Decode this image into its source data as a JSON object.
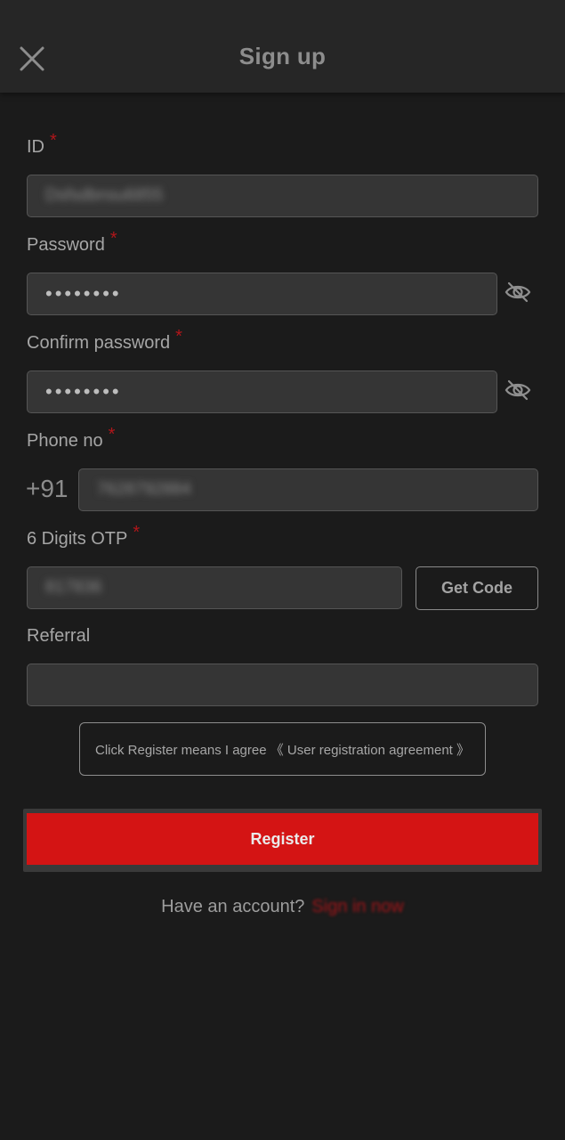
{
  "header": {
    "title": "Sign up",
    "close_icon": "close-icon"
  },
  "form": {
    "required_mark": "*",
    "id": {
      "label": "ID",
      "value": "Dsfsdbnsu6855"
    },
    "password": {
      "label": "Password",
      "value": "••••••••",
      "toggle_icon": "eye-off-icon"
    },
    "confirm_password": {
      "label": "Confirm password",
      "value": "••••••••",
      "toggle_icon": "eye-off-icon"
    },
    "phone": {
      "label": "Phone no",
      "prefix": "+91",
      "value": "7628792884"
    },
    "otp": {
      "label": "6 Digits OTP",
      "value": "817836",
      "get_code_label": "Get Code"
    },
    "referral": {
      "label": "Referral",
      "value": ""
    }
  },
  "agreement": {
    "text": "Click Register means I agree 《 User registration agreement 》"
  },
  "register": {
    "label": "Register"
  },
  "footer": {
    "question": "Have an account?",
    "link": "Sign in now"
  },
  "colors": {
    "background": "#1b1b1b",
    "header": "#262626",
    "input": "#353535",
    "accent": "#d41414",
    "required": "#b0161a"
  }
}
